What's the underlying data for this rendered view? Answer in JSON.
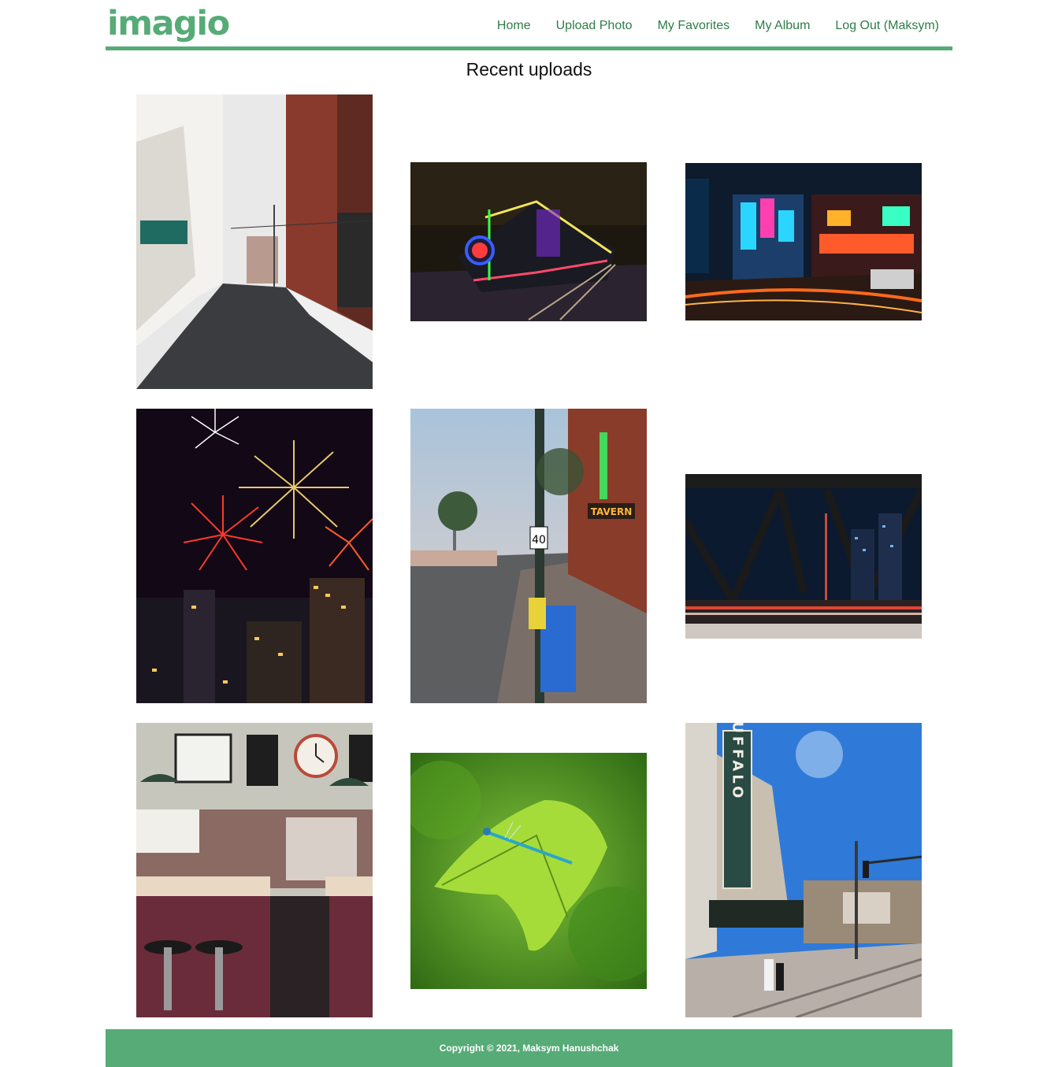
{
  "brand": {
    "logo_text": "imagio",
    "accent_color": "#56ab77"
  },
  "nav": {
    "items": [
      {
        "label": "Home"
      },
      {
        "label": "Upload Photo"
      },
      {
        "label": "My Favorites"
      },
      {
        "label": "My Album"
      },
      {
        "label": "Log Out (Maksym)"
      }
    ]
  },
  "page": {
    "title": "Recent uploads"
  },
  "gallery": {
    "photos": [
      {
        "subject": "snowy-alley"
      },
      {
        "subject": "holiday-train"
      },
      {
        "subject": "neon-street-night"
      },
      {
        "subject": "fireworks-city"
      },
      {
        "subject": "tavern-street-cn-tower",
        "sign_text": "TAVERN",
        "speed_sign": "40"
      },
      {
        "subject": "bridge-city-night"
      },
      {
        "subject": "diner-interior"
      },
      {
        "subject": "damselfly-leaf"
      },
      {
        "subject": "buffalo-theatre",
        "sign_text": "BUFFALO"
      }
    ]
  },
  "footer": {
    "copyright": "Copyright © 2021, Maksym Hanushchak"
  }
}
